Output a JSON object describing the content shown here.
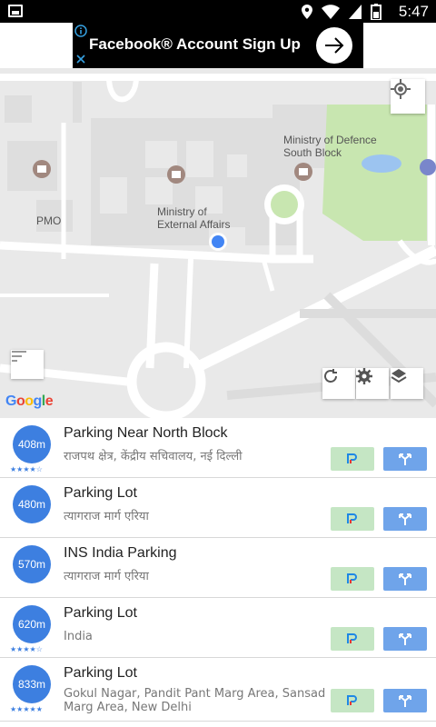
{
  "status_bar": {
    "time": "5:47"
  },
  "ad": {
    "text": "Facebook® Account Sign Up"
  },
  "map": {
    "labels": {
      "ministry_defence": "Ministry of Defence\nSouth Block",
      "ministry_external": "Ministry of\nExternal Affairs",
      "pmo": "PMO"
    },
    "google_logo": "Google"
  },
  "list": [
    {
      "distance": "408m",
      "title": "Parking Near North Block",
      "address": "राजपथ क्षेत्र, केंद्रीय सचिवालय, नई दिल्ली",
      "rating": 3.5,
      "stars": "★★★★☆"
    },
    {
      "distance": "480m",
      "title": "Parking Lot",
      "address": "त्यागराज मार्ग एरिया",
      "rating": 0,
      "stars": ""
    },
    {
      "distance": "570m",
      "title": "INS India Parking",
      "address": "त्यागराज मार्ग एरिया",
      "rating": 0,
      "stars": ""
    },
    {
      "distance": "620m",
      "title": "Parking Lot",
      "address": "India",
      "rating": 4,
      "stars": "★★★★☆"
    },
    {
      "distance": "833m",
      "title": "Parking Lot",
      "address": "Gokul Nagar, Pandit Pant Marg Area, Sansad Marg Area, New Delhi",
      "rating": 5,
      "stars": "★★★★★"
    }
  ],
  "colors": {
    "accent": "#3d7fe0",
    "park_button": "#c5e6c4",
    "nav_button": "#6fa4ea",
    "map_bg": "#e9e9e9",
    "park_green": "#c8e6b0"
  }
}
